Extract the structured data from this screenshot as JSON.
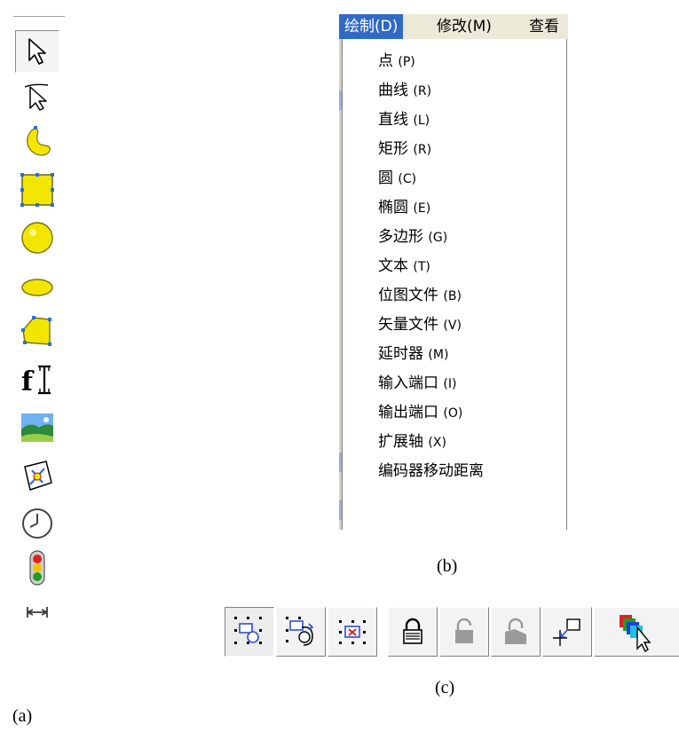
{
  "captions": {
    "a": "(a)",
    "b": "(b)",
    "c": "(c)"
  },
  "toolbar_a": {
    "tools": [
      {
        "icon": "pointer-arrow-icon",
        "selected": true
      },
      {
        "icon": "point-tool-icon"
      },
      {
        "icon": "curve-tool-icon"
      },
      {
        "icon": "rectangle-tool-icon"
      },
      {
        "icon": "circle-tool-icon"
      },
      {
        "icon": "ellipse-tool-icon"
      },
      {
        "icon": "polygon-tool-icon"
      },
      {
        "icon": "text-tool-icon"
      },
      {
        "icon": "bitmap-tool-icon"
      },
      {
        "icon": "vector-tool-icon"
      },
      {
        "icon": "timer-tool-icon"
      },
      {
        "icon": "io-port-tool-icon"
      },
      {
        "icon": "extend-axis-tool-icon"
      }
    ],
    "text_icon_glyph": "f",
    "colors": {
      "shape_fill": "#f2e600",
      "shape_stroke": "#7a7000",
      "handle": "#2f6fd0"
    }
  },
  "menu": {
    "bar": [
      {
        "label": "绘制(D)",
        "selected": true
      },
      {
        "label": "修改(M)"
      },
      {
        "label": "查看"
      }
    ],
    "items": [
      {
        "label": "点",
        "accel": "(P)"
      },
      {
        "label": "曲线",
        "accel": "(R)"
      },
      {
        "label": "直线",
        "accel": "(L)"
      },
      {
        "label": "矩形",
        "accel": "(R)"
      },
      {
        "label": "圆",
        "accel": "(C)"
      },
      {
        "label": "椭圆",
        "accel": "(E)"
      },
      {
        "label": "多边形",
        "accel": "(G)"
      },
      {
        "label": "文本",
        "accel": "(T)"
      },
      {
        "label": "位图文件",
        "accel": "(B)"
      },
      {
        "label": "矢量文件",
        "accel": "(V)"
      },
      {
        "label": "延时器",
        "accel": "(M)"
      },
      {
        "label": "输入端口",
        "accel": "(I)"
      },
      {
        "label": "输出端口",
        "accel": "(O)"
      },
      {
        "label": "扩展轴",
        "accel": "(X)"
      },
      {
        "label": "编码器移动距离",
        "accel": ""
      }
    ],
    "colors": {
      "highlight": "#316ac5",
      "bar_bg": "#ece9d8"
    }
  },
  "toolbar_c": {
    "buttons": [
      {
        "icon": "select-move-icon",
        "pressed": true
      },
      {
        "icon": "select-rotate-icon"
      },
      {
        "icon": "select-delete-icon"
      },
      {
        "icon": "lock-icon"
      },
      {
        "icon": "unlock-icon"
      },
      {
        "icon": "lock-all-icon"
      },
      {
        "icon": "origin-offset-icon"
      },
      {
        "icon": "layer-color-icon"
      }
    ]
  }
}
